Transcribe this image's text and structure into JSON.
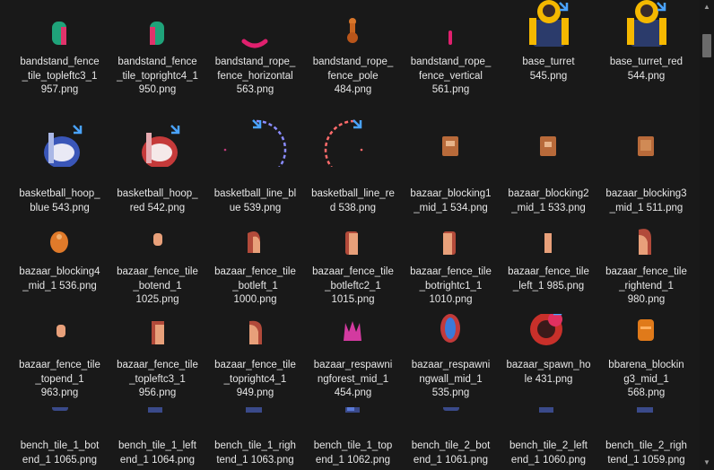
{
  "files": [
    {
      "name": "bandstand_fence\n_tile_topleftc3_1\n957.png",
      "icon": "fence-corner-icon"
    },
    {
      "name": "bandstand_fence\n_tile_toprightc4_1\n950.png",
      "icon": "fence-corner-icon"
    },
    {
      "name": "bandstand_rope_\nfence_horizontal\n563.png",
      "icon": "rope-horizontal-icon"
    },
    {
      "name": "bandstand_rope_\nfence_pole\n484.png",
      "icon": "fence-pole-icon"
    },
    {
      "name": "bandstand_rope_\nfence_vertical\n561.png",
      "icon": "rope-vertical-icon"
    },
    {
      "name": "base_turret\n545.png",
      "icon": "turret-icon"
    },
    {
      "name": "base_turret_red\n544.png",
      "icon": "turret-icon"
    },
    {
      "name": "basketball_hoop_\nblue 543.png",
      "icon": "hoop-icon"
    },
    {
      "name": "basketball_hoop_\nred 542.png",
      "icon": "hoop-icon"
    },
    {
      "name": "basketball_line_bl\nue 539.png",
      "icon": "dashed-arc-icon"
    },
    {
      "name": "basketball_line_re\nd 538.png",
      "icon": "dashed-arc-icon"
    },
    {
      "name": "bazaar_blocking1\n_mid_1 534.png",
      "icon": "crate-icon"
    },
    {
      "name": "bazaar_blocking2\n_mid_1 533.png",
      "icon": "crate-icon"
    },
    {
      "name": "bazaar_blocking3\n_mid_1 511.png",
      "icon": "crate-icon"
    },
    {
      "name": "bazaar_blocking4\n_mid_1 536.png",
      "icon": "sack-icon"
    },
    {
      "name": "bazaar_fence_tile\n_botend_1\n1025.png",
      "icon": "fence-tile-icon"
    },
    {
      "name": "bazaar_fence_tile\n_botleft_1\n1000.png",
      "icon": "fence-tile-icon"
    },
    {
      "name": "bazaar_fence_tile\n_botleftc2_1\n1015.png",
      "icon": "fence-tile-icon"
    },
    {
      "name": "bazaar_fence_tile\n_botrightc1_1\n1010.png",
      "icon": "fence-tile-icon"
    },
    {
      "name": "bazaar_fence_tile\n_left_1 985.png",
      "icon": "fence-tile-icon"
    },
    {
      "name": "bazaar_fence_tile\n_rightend_1\n980.png",
      "icon": "fence-tile-icon"
    },
    {
      "name": "bazaar_fence_tile\n_topend_1\n963.png",
      "icon": "fence-tile-icon"
    },
    {
      "name": "bazaar_fence_tile\n_topleftc3_1\n956.png",
      "icon": "fence-tile-icon"
    },
    {
      "name": "bazaar_fence_tile\n_toprightc4_1\n949.png",
      "icon": "fence-tile-icon"
    },
    {
      "name": "bazaar_respawni\nngforest_mid_1\n454.png",
      "icon": "forest-icon"
    },
    {
      "name": "bazaar_respawni\nngwall_mid_1\n535.png",
      "icon": "wall-icon"
    },
    {
      "name": "bazaar_spawn_ho\nle 431.png",
      "icon": "spawn-hole-icon"
    },
    {
      "name": "bbarena_blockin\ng3_mid_1\n568.png",
      "icon": "barrel-icon"
    },
    {
      "name": "bench_tile_1_bot\nend_1 1065.png",
      "icon": "bench-icon"
    },
    {
      "name": "bench_tile_1_left\nend_1 1064.png",
      "icon": "bench-icon"
    },
    {
      "name": "bench_tile_1_righ\ntend_1 1063.png",
      "icon": "bench-icon"
    },
    {
      "name": "bench_tile_1_top\nend_1 1062.png",
      "icon": "bench-icon"
    },
    {
      "name": "bench_tile_2_bot\nend_1 1061.png",
      "icon": "bench-icon"
    },
    {
      "name": "bench_tile_2_left\nend_1 1060.png",
      "icon": "bench-icon"
    },
    {
      "name": "bench_tile_2_righ\ntend_1 1059.png",
      "icon": "bench-icon"
    }
  ],
  "scrollbar": {
    "up": "▲",
    "down": "▼"
  }
}
